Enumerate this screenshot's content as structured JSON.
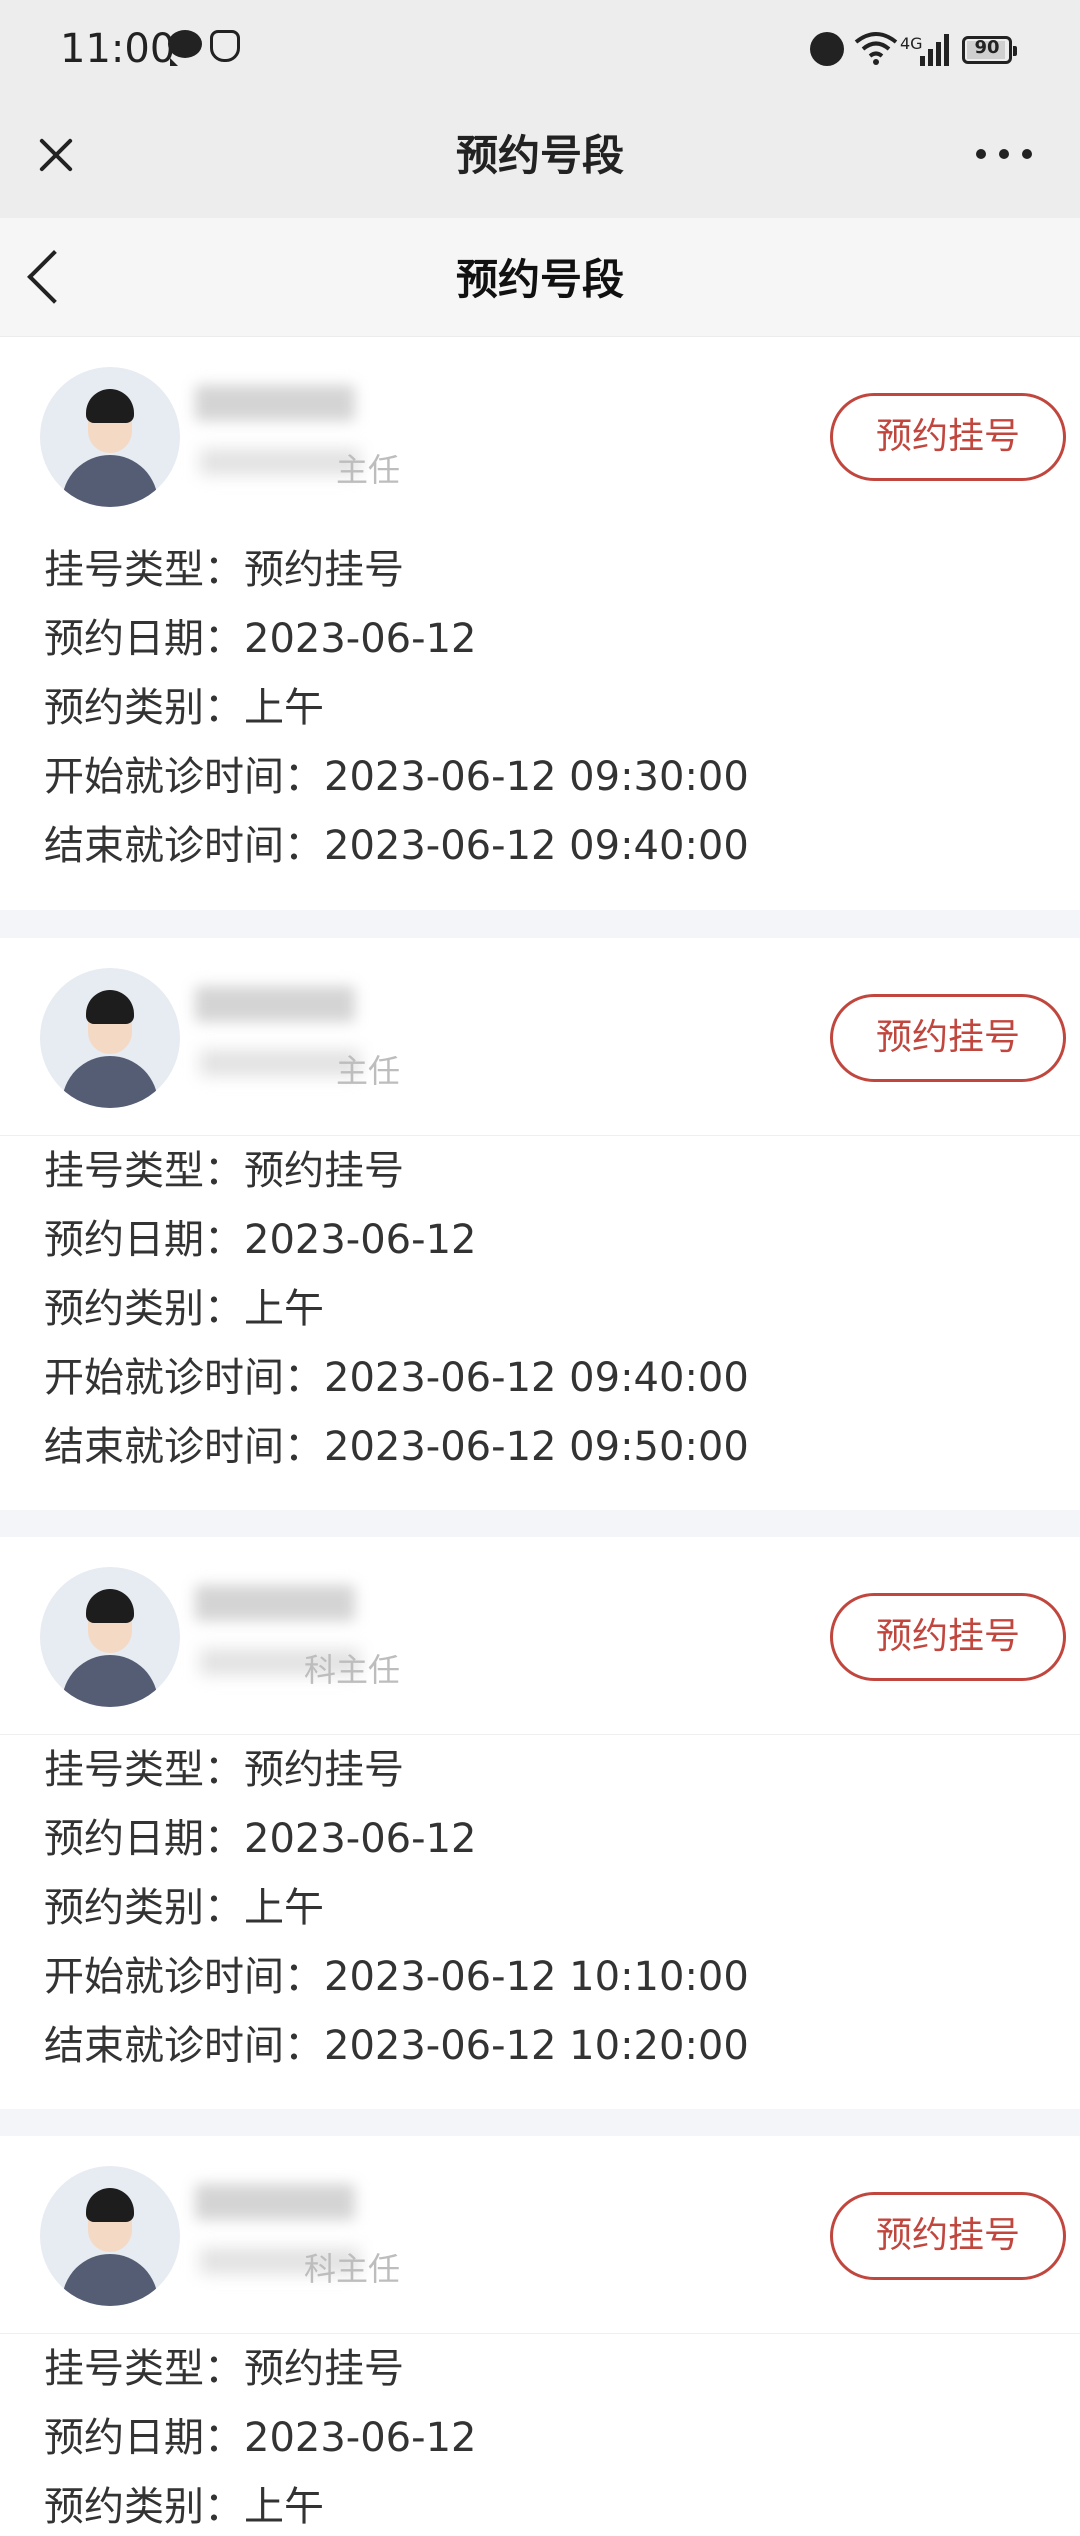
{
  "status_bar": {
    "time": "11:00",
    "network": "4G",
    "battery": "90",
    "icons": [
      "chat-icon",
      "shield-icon",
      "alarm-icon",
      "wifi-icon",
      "signal-icon",
      "battery-icon"
    ]
  },
  "wechat_bar": {
    "title": "预约号段",
    "close_icon": "close-icon",
    "more_icon": "more-icon"
  },
  "page_header": {
    "title": "预约号段",
    "back_icon": "back-icon"
  },
  "doctors": [
    {
      "title_suffix": "主任",
      "button_label": "预约挂号",
      "rows": [
        {
          "label": "挂号类型：",
          "value": "预约挂号"
        },
        {
          "label": "预约日期：",
          "value": "2023-06-12"
        },
        {
          "label": "预约类别：",
          "value": "上午"
        },
        {
          "label": "开始就诊时间：",
          "value": "2023-06-12 09:30:00"
        },
        {
          "label": "结束就诊时间：",
          "value": "2023-06-12 09:40:00"
        }
      ]
    },
    {
      "title_suffix": "主任",
      "button_label": "预约挂号",
      "rows": [
        {
          "label": "挂号类型：",
          "value": "预约挂号"
        },
        {
          "label": "预约日期：",
          "value": "2023-06-12"
        },
        {
          "label": "预约类别：",
          "value": "上午"
        },
        {
          "label": "开始就诊时间：",
          "value": "2023-06-12 09:40:00"
        },
        {
          "label": "结束就诊时间：",
          "value": "2023-06-12 09:50:00"
        }
      ]
    },
    {
      "title_suffix": "科主任",
      "button_label": "预约挂号",
      "rows": [
        {
          "label": "挂号类型：",
          "value": "预约挂号"
        },
        {
          "label": "预约日期：",
          "value": "2023-06-12"
        },
        {
          "label": "预约类别：",
          "value": "上午"
        },
        {
          "label": "开始就诊时间：",
          "value": "2023-06-12 10:10:00"
        },
        {
          "label": "结束就诊时间：",
          "value": "2023-06-12 10:20:00"
        }
      ]
    },
    {
      "title_suffix": "科主任",
      "button_label": "预约挂号",
      "rows": [
        {
          "label": "挂号类型：",
          "value": "预约挂号"
        },
        {
          "label": "预约日期：",
          "value": "2023-06-12"
        },
        {
          "label": "预约类别：",
          "value": "上午"
        }
      ]
    }
  ]
}
